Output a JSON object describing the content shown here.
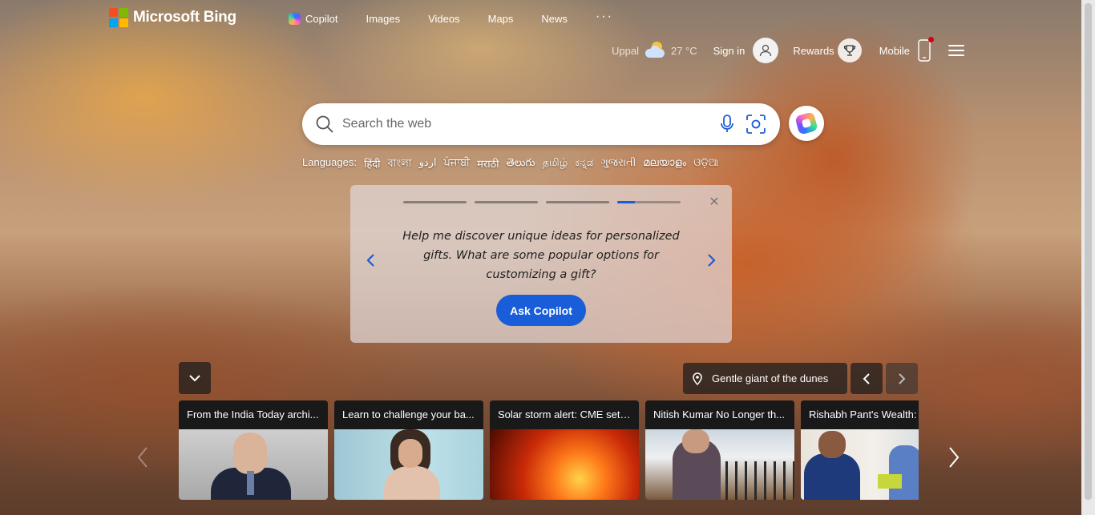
{
  "header": {
    "brand": "Microsoft Bing",
    "brand_colors": [
      "#f25022",
      "#7fba00",
      "#00a4ef",
      "#ffb900"
    ],
    "nav": [
      {
        "label": "Copilot",
        "icon": "copilot-icon"
      },
      {
        "label": "Images"
      },
      {
        "label": "Videos"
      },
      {
        "label": "Maps"
      },
      {
        "label": "News"
      }
    ],
    "more_label": "···"
  },
  "topbar": {
    "location": "Uppal",
    "temperature": "27 °C",
    "weather_icon": "partly-cloudy-icon",
    "sign_in": "Sign in",
    "rewards": "Rewards",
    "mobile": "Mobile"
  },
  "search": {
    "placeholder": "Search the web"
  },
  "languages": {
    "label": "Languages:",
    "items": [
      "हिंदी",
      "বাংলা",
      "اردو",
      "ਪੰਜਾਬੀ",
      "मराठी",
      "తెలుగు",
      "தமிழ்",
      "ಕನ್ನಡ",
      "ગુજરાતી",
      "മലയാളം",
      "ଓଡ଼ିଆ"
    ]
  },
  "copilot_card": {
    "progress": [
      1,
      1,
      1,
      0.28
    ],
    "prompt": "Help me discover unique ideas for personalized gifts. What are some popular options for customizing a gift?",
    "button": "Ask Copilot",
    "accent": "#1a5dd8"
  },
  "background": {
    "caption": "Gentle giant of the dunes"
  },
  "news": [
    {
      "title": "From the India Today archi..."
    },
    {
      "title": "Learn to challenge your ba..."
    },
    {
      "title": "Solar storm alert: CME set ..."
    },
    {
      "title": "Nitish Kumar No Longer th..."
    },
    {
      "title": "Rishabh Pant's Wealth: B..."
    }
  ]
}
